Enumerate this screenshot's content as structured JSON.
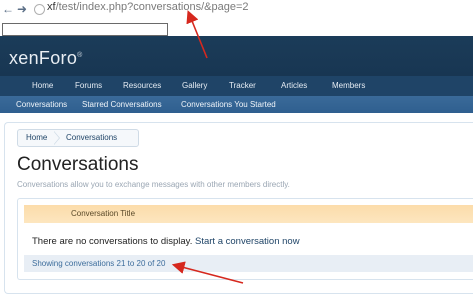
{
  "browser": {
    "url_host": "xf",
    "url_path": "/test/index.php?conversations/&page=2",
    "icons": {
      "back": "back-arrow-icon",
      "forward": "forward-arrow-icon",
      "site": "site-info-icon"
    }
  },
  "header": {
    "logo_text": "xenForo",
    "logo_mark": "®"
  },
  "navtabs": [
    "Home",
    "Forums",
    "Resources",
    "Gallery",
    "Tracker",
    "Articles",
    "Members"
  ],
  "subnav": [
    "Conversations",
    "Starred Conversations",
    "Conversations You Started"
  ],
  "breadcrumb": [
    "Home",
    "Conversations"
  ],
  "page": {
    "title": "Conversations",
    "description": "Conversations allow you to exchange messages with other members directly."
  },
  "list": {
    "column_header": "Conversation Title",
    "empty_message": "There are no conversations to display.",
    "start_link": "Start a conversation now",
    "footer": "Showing conversations 21 to 20 of 20"
  },
  "colors": {
    "header": "#1b3c59",
    "navtabs": "#1f4467",
    "subnav": "#2f5f8f",
    "list_header": "#fcdcaa",
    "annotation_arrow": "#d6281e"
  }
}
